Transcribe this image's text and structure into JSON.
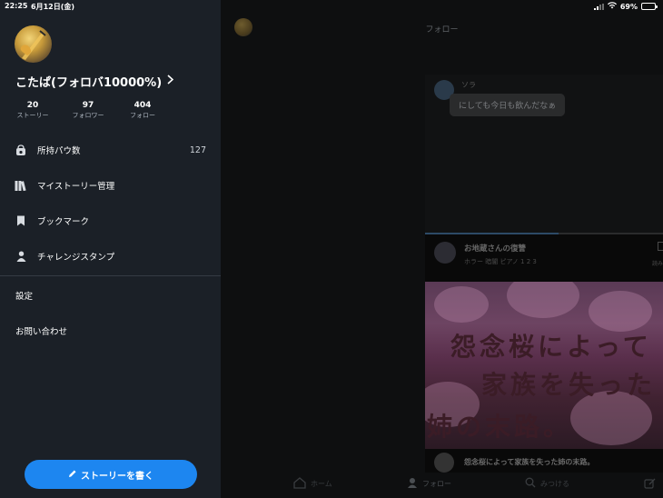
{
  "status_bar": {
    "time": "22:25",
    "date": "6月12日(金)",
    "battery": "69%",
    "battery_level": 0.69
  },
  "drawer": {
    "profile_name": "こたぱ(フォロバ10000%)",
    "stats": [
      {
        "value": "20",
        "label": "ストーリー"
      },
      {
        "value": "97",
        "label": "フォロワー"
      },
      {
        "value": "404",
        "label": "フォロー"
      }
    ],
    "menu": [
      {
        "label": "所持パウ数",
        "count": "127",
        "icon": "paw-bag-icon"
      },
      {
        "label": "マイストーリー管理",
        "icon": "bookshelf-icon"
      },
      {
        "label": "ブックマーク",
        "icon": "bookmark-icon"
      },
      {
        "label": "チャレンジスタンプ",
        "icon": "person-icon"
      }
    ],
    "settings_label": "設定",
    "contact_label": "お問い合わせ",
    "write_button_label": "ストーリーを書く"
  },
  "main": {
    "title": "フォロー",
    "chat": {
      "name": "ソラ",
      "message": "にしても今日も飲んだなぁ",
      "progress": 0.56
    },
    "story": {
      "title": "お地蔵さんの復讐",
      "tags": "ホラー 暗闇 ピアノ 1 2 3",
      "side_label": "読み",
      "cover_lines": [
        "怨念桜によって",
        "家族を失った",
        "姉の末路。"
      ],
      "caption": "怨念桜によって家族を失った姉の末路。"
    },
    "tabs": [
      {
        "label": "ホーム",
        "icon": "home-icon"
      },
      {
        "label": "フォロー",
        "icon": "person-icon"
      },
      {
        "label": "みつける",
        "icon": "search-icon"
      },
      {
        "label": "",
        "icon": "compose-icon"
      }
    ]
  },
  "colors": {
    "drawer_bg": "#1b2027",
    "accent": "#1d86f0"
  }
}
